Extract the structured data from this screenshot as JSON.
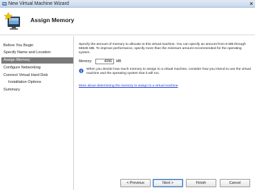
{
  "window": {
    "title": "New Virtual Machine Wizard",
    "close_glyph": "×"
  },
  "header": {
    "title": "Assign Memory",
    "icon": "wizard-memory-icon"
  },
  "sidebar": {
    "items": [
      {
        "label": "Before You Begin",
        "active": false,
        "sub": false
      },
      {
        "label": "Specify Name and Location",
        "active": false,
        "sub": false
      },
      {
        "label": "Assign Memory",
        "active": true,
        "sub": false
      },
      {
        "label": "Configure Networking",
        "active": false,
        "sub": false
      },
      {
        "label": "Connect Virtual Hard Disk",
        "active": false,
        "sub": false
      },
      {
        "label": "Installation Options",
        "active": false,
        "sub": true
      },
      {
        "label": "Summary",
        "active": false,
        "sub": false
      }
    ]
  },
  "main": {
    "description": "Specify the amount of memory to allocate to this virtual machine. You can specify an amount from 8 MB through 65536 MB. To improve performance, specify more than the minimum amount recommended for the operating system.",
    "memory_label": "Memory:",
    "memory_value": "4096",
    "memory_unit": "MB",
    "info_icon": "info-icon",
    "info_text": "When you decide how much memory to assign to a virtual machine, consider how you intend to use the virtual machine and the operating system that it will run.",
    "more_link": "More about determining the memory to assign to a virtual machine"
  },
  "footer": {
    "previous": "< Previous",
    "next": "Next >",
    "finish": "Finish",
    "cancel": "Cancel"
  },
  "colors": {
    "active_nav_bg": "#7a7a7a",
    "link": "#1b3fd6",
    "titlebar": "#c9d9ee"
  }
}
